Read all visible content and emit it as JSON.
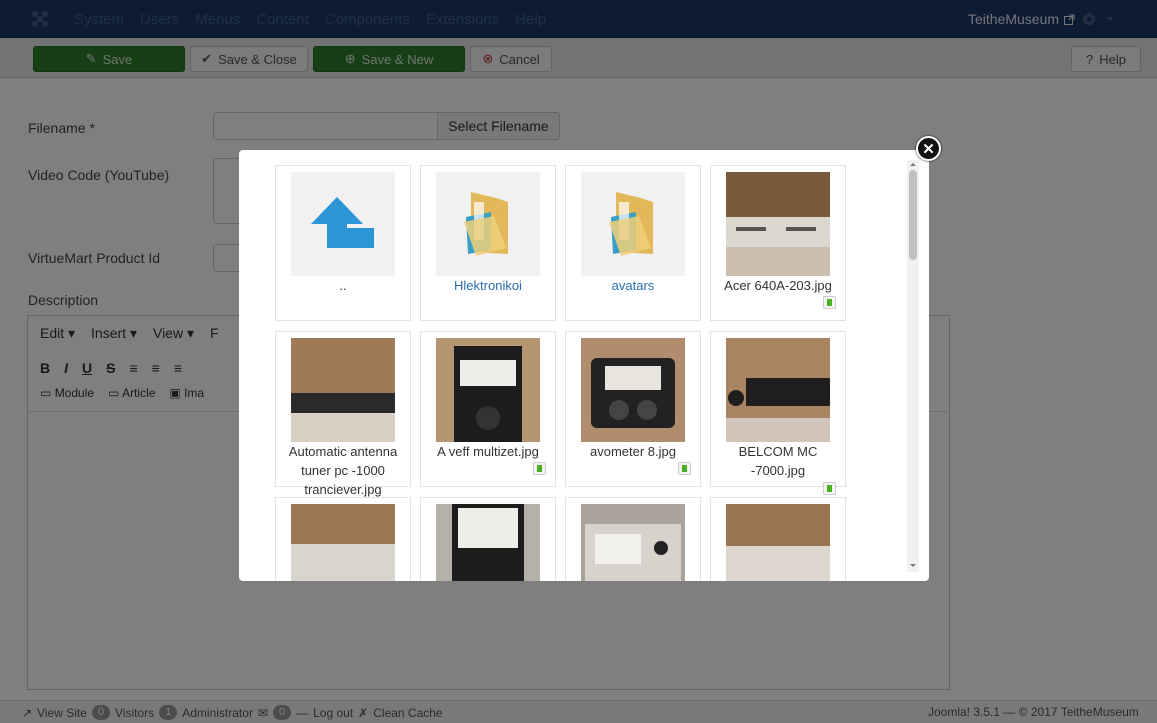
{
  "topnav": {
    "menu": [
      "System",
      "Users",
      "Menus",
      "Content",
      "Components",
      "Extensions",
      "Help"
    ],
    "site_name": "TeitheMuseum"
  },
  "toolbar": {
    "save": "Save",
    "save_close": "Save & Close",
    "save_new": "Save & New",
    "cancel": "Cancel",
    "help": "Help"
  },
  "form": {
    "filename_label": "Filename *",
    "select_filename": "Select Filename",
    "video_label": "Video Code (YouTube)",
    "product_label": "VirtueMart Product Id",
    "description_label": "Description"
  },
  "editor": {
    "menu": [
      "Edit ▾",
      "Insert ▾",
      "View ▾",
      "F"
    ],
    "format_buttons": [
      "B",
      "I",
      "U",
      "S",
      "≡",
      "≡",
      "≡"
    ],
    "insert_buttons": [
      "Module",
      "Article",
      "Ima"
    ]
  },
  "modal": {
    "items": [
      {
        "label": "..",
        "kind": "up"
      },
      {
        "label": "Hlektronikoi",
        "kind": "folder"
      },
      {
        "label": "avatars",
        "kind": "folder"
      },
      {
        "label": "Acer 640A-203.jpg",
        "kind": "image"
      },
      {
        "label": "Automatic antenna tuner pc -1000 tranciever.jpg",
        "kind": "image"
      },
      {
        "label": "A veff multizet.jpg",
        "kind": "image"
      },
      {
        "label": "avometer 8.jpg",
        "kind": "image"
      },
      {
        "label": "BELCOM MC -7000.jpg",
        "kind": "image"
      },
      {
        "label": "",
        "kind": "image"
      },
      {
        "label": "",
        "kind": "image"
      },
      {
        "label": "",
        "kind": "image"
      },
      {
        "label": "",
        "kind": "image"
      }
    ]
  },
  "status": {
    "view_site": "View Site",
    "visitors_count": "0",
    "visitors": "Visitors",
    "admin_count": "1",
    "administrator": "Administrator",
    "messages_count": "0",
    "logout": "Log out",
    "clean_cache": "Clean Cache",
    "version": "Joomla! 3.5.1 — © 2017 TeitheMuseum"
  }
}
